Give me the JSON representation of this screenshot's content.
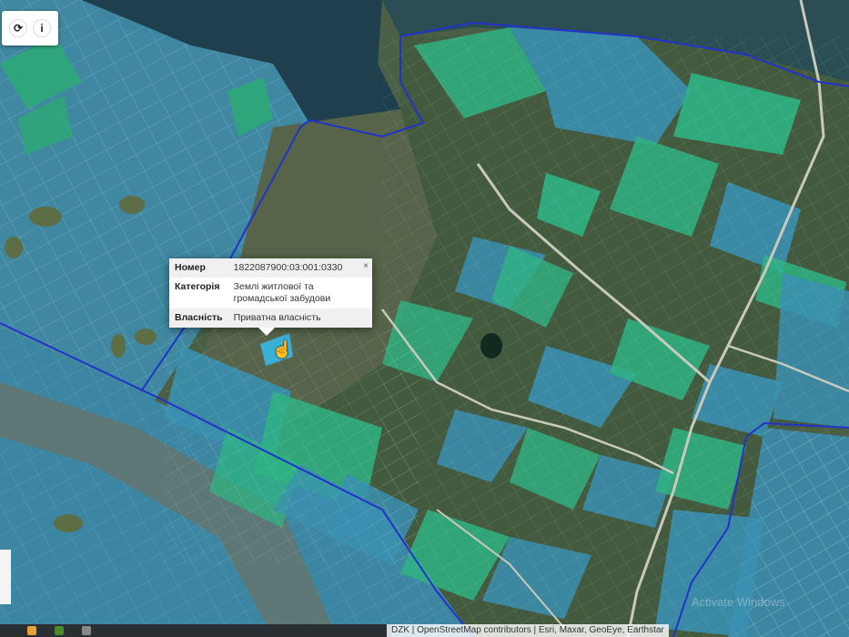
{
  "toolbar": {
    "buttons": [
      {
        "icon": "refresh-icon",
        "glyph": "⟳"
      },
      {
        "icon": "info-icon",
        "glyph": "i"
      }
    ]
  },
  "popup": {
    "close": "×",
    "rows": [
      {
        "label": "Номер",
        "value": "1822087900:03:001:0330"
      },
      {
        "label": "Категорія",
        "value": "Землі житлової та громадської забудови"
      },
      {
        "label": "Власність",
        "value": "Приватна власність"
      }
    ]
  },
  "attribution": "DZK | OpenStreetMap contributors | Esri, Maxar, GeoEye, Earthstar",
  "watermark": "Activate Windows",
  "colors": {
    "water": "#1d4a58",
    "field": "#3f5f46",
    "parcel_blue": "#3a8fb0",
    "parcel_green": "#2fb383",
    "boundary": "#2233cc",
    "road": "#c9c9bd"
  }
}
